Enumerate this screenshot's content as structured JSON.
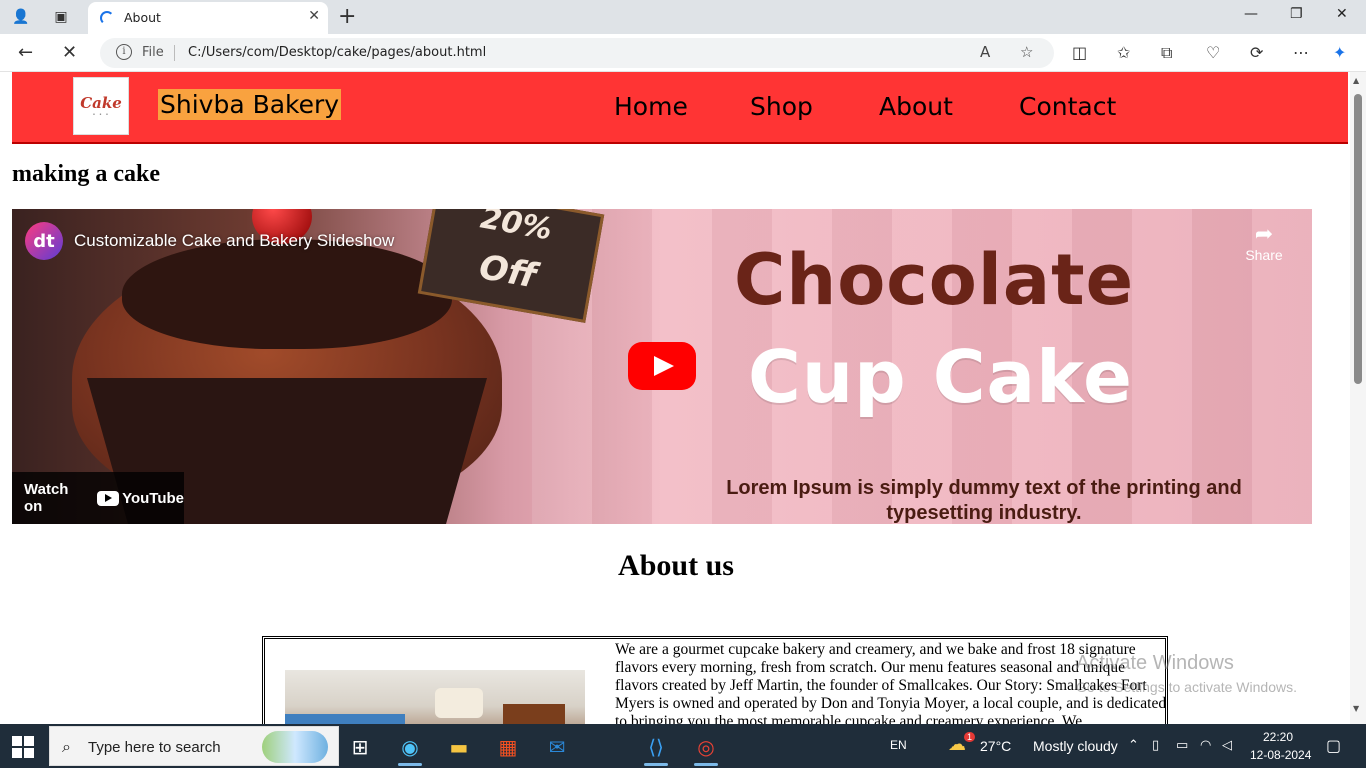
{
  "browser": {
    "tab_title": "About",
    "scheme_label": "File",
    "url": "C:/Users/com/Desktop/cake/pages/about.html"
  },
  "site": {
    "brand": "Shivba Bakery",
    "logo_text": "Cake",
    "nav": [
      "Home",
      "Shop",
      "About",
      "Contact"
    ],
    "section_heading": "making a cake",
    "about_heading": "About us",
    "about_text": "We are a gourmet cupcake bakery and creamery, and we bake and frost 18 signature flavors every morning, fresh from scratch. Our menu features seasonal and unique flavors created by Jeff Martin, the founder of Smallcakes. Our Story: Smallcakes Fort Myers is owned and operated by Don and Tonyia Moyer, a local couple, and is dedicated to bringing you the most memorable cupcake and creamery experience. We"
  },
  "video": {
    "title": "Customizable Cake and Bakery Slideshow",
    "channel_initials": "dt",
    "share_label": "Share",
    "watch_on": "Watch on",
    "youtube": "YouTube",
    "promo_top": "20%",
    "promo": "Off",
    "headline1": "Chocolate",
    "headline2": "Cup Cake",
    "caption": "Lorem Ipsum is simply dummy text of the printing and typesetting industry."
  },
  "watermark": {
    "title": "Activate Windows",
    "subtitle": "Go to Settings to activate Windows."
  },
  "taskbar": {
    "search_placeholder": "Type here to search",
    "language": "EN",
    "temperature": "27°C",
    "weather": "Mostly cloudy",
    "time": "22:20",
    "date": "12-08-2024",
    "weather_badge": "1"
  },
  "colors": {
    "header_bg": "#ff3434",
    "brand_bg": "#f9a23f",
    "taskbar_bg": "#1f2d3a",
    "youtube_red": "#ff0000"
  }
}
